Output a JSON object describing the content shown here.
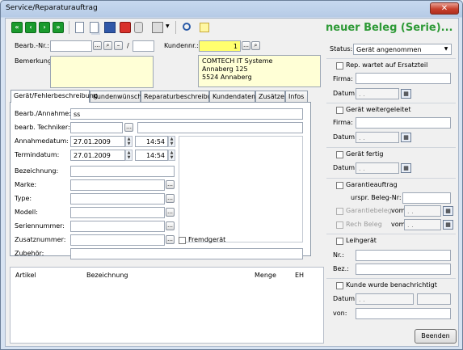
{
  "window": {
    "title": "Service/Reparaturauftrag"
  },
  "toolbar": {
    "icons": [
      "first-record-icon",
      "previous-record-icon",
      "next-record-icon",
      "last-record-icon",
      "new-document-icon",
      "copy-icon",
      "save-icon",
      "stop-icon",
      "pause-icon",
      "print-icon",
      "print-dropdown-icon",
      "search-icon",
      "note-icon"
    ],
    "nav_labels": [
      "«",
      "‹",
      "›",
      "»"
    ]
  },
  "header": {
    "beleg_title": "neuer Beleg (Serie)...",
    "bearb_nr_label": "Bearb.-Nr.:",
    "bearb_nr_value": "",
    "slash": "/",
    "kundennr_label": "Kundennr.:",
    "kundennr_value": "1",
    "bemerkung_label": "Bemerkung",
    "address_lines": [
      "COMTECH IT Systeme",
      "Annaberg 125",
      "5524 Annaberg"
    ]
  },
  "tabs": [
    {
      "label": "Gerät/Fehlerbeschreibung",
      "active": true
    },
    {
      "label": "Kundenwünsche",
      "active": false
    },
    {
      "label": "Reparaturbeschreibung",
      "active": false
    },
    {
      "label": "Kundendaten",
      "active": false
    },
    {
      "label": "Zusätze",
      "active": false
    },
    {
      "label": "Infos",
      "active": false
    }
  ],
  "form": {
    "bearb_annahme_label": "Bearb./Annahme:",
    "bearb_annahme_value": "ss",
    "techniker_label": "bearb. Techniker:",
    "techniker_value": "",
    "annahmedatum_label": "Annahmedatum:",
    "annahmedatum_value": "27.01.2009",
    "annahmezeit_value": "14:54",
    "termindatum_label": "Termindatum:",
    "termindatum_value": "27.01.2009",
    "terminzeit_value": "14:54",
    "bezeichnung_label": "Bezeichnung:",
    "marke_label": "Marke:",
    "type_label": "Type:",
    "modell_label": "Modell:",
    "seriennummer_label": "Seriennummer:",
    "zusatznummer_label": "Zusatznummer:",
    "fremdgeraet_label": "Fremdgerät",
    "zubehoer_label": "Zubehör:"
  },
  "grid": {
    "columns": [
      "Artikel",
      "Bezeichnung",
      "Menge",
      "EH"
    ]
  },
  "status_panel": {
    "status_label": "Status:",
    "status_value": "Gerät angenommen",
    "rep_wartet_label": "Rep. wartet auf Ersatzteil",
    "firma_label": "Firma:",
    "datum_label": "Datum:",
    "date_placeholder": ". .",
    "weitergeleitet_label": "Gerät weitergeleitet",
    "fertig_label": "Gerät fertig",
    "garantie_label": "Garantieauftrag",
    "urspr_beleg_label": "urspr. Beleg-Nr:",
    "garantiebeleg_label": "Garantiebeleg",
    "vom_label": "vom:",
    "rech_beleg_label": "Rech Beleg",
    "leihgeraet_label": "Leihgerät",
    "nr_label": "Nr.:",
    "bez_label": "Bez.:",
    "benachrichtigt_label": "Kunde wurde benachrichtigt",
    "von_label": "von:"
  },
  "footer": {
    "beenden_label": "Beenden"
  },
  "colors": {
    "accent_green": "#2e9a37",
    "kunde_yellow": "#ffff6e",
    "bemerkung_cream": "#ffffd6"
  }
}
